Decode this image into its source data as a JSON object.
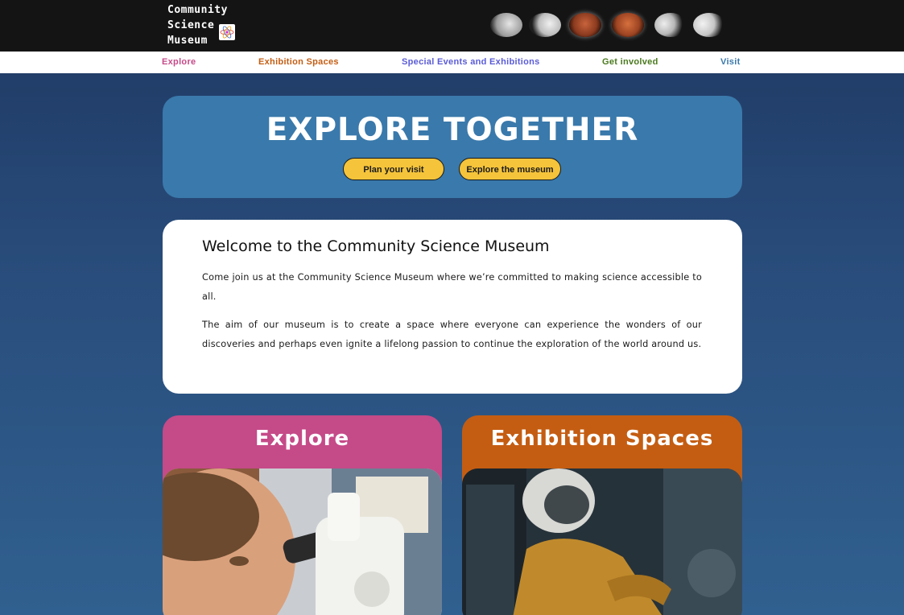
{
  "logo": {
    "lines": [
      "Community",
      "Science",
      "Museum"
    ]
  },
  "nav": {
    "items": [
      {
        "label": "Explore",
        "color": "#c54a88"
      },
      {
        "label": "Exhibition Spaces",
        "color": "#c45d12"
      },
      {
        "label": "Special Events and Exhibitions",
        "color": "#5a5bd6"
      },
      {
        "label": "Get involved",
        "color": "#4a7a1e"
      },
      {
        "label": "Visit",
        "color": "#3a79ab"
      }
    ]
  },
  "hero": {
    "title": "EXPLORE TOGETHER",
    "buttons": [
      "Plan your visit",
      "Explore the museum"
    ]
  },
  "welcome": {
    "heading": "Welcome to the Community Science Museum",
    "paragraphs": [
      "Come join us at the Community Science Museum where we’re committed to making science accessible to all.",
      "The aim of our museum is to create a space where everyone can experience the wonders of our discoveries and perhaps even ignite a lifelong passion to continue the exploration of the world around us."
    ]
  },
  "cards": [
    {
      "title": "Explore",
      "color": "#c54a88"
    },
    {
      "title": "Exhibition Spaces",
      "color": "#c45d12"
    }
  ],
  "colors": {
    "header_bg": "#141414",
    "hero_bg": "#3a79ab",
    "button_bg": "#f5c43a"
  },
  "icons": [
    "atom-icon",
    "moon-phase-image"
  ]
}
